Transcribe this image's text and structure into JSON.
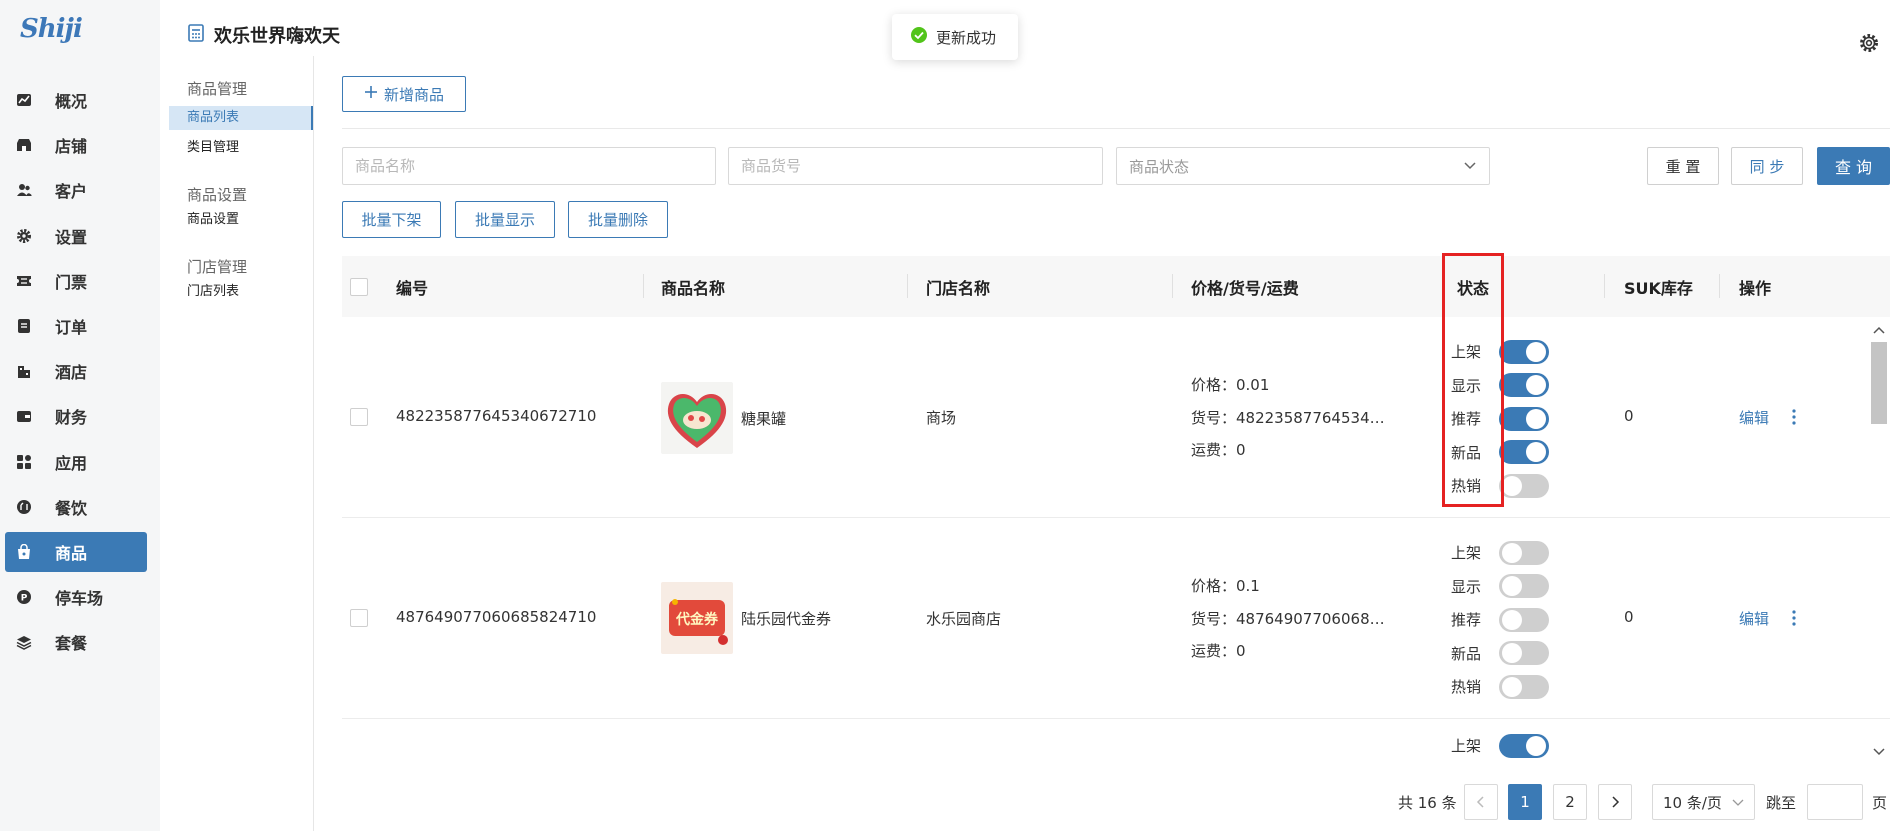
{
  "app": {
    "logo": "Shiji",
    "page_title": "欢乐世界嗨欢天"
  },
  "toast": {
    "message": "更新成功"
  },
  "sidebar": {
    "items": [
      {
        "label": "概况",
        "icon": "chart-icon"
      },
      {
        "label": "店铺",
        "icon": "store-icon"
      },
      {
        "label": "客户",
        "icon": "users-icon"
      },
      {
        "label": "设置",
        "icon": "gear-icon"
      },
      {
        "label": "门票",
        "icon": "ticket-icon"
      },
      {
        "label": "订单",
        "icon": "order-icon"
      },
      {
        "label": "酒店",
        "icon": "hotel-icon"
      },
      {
        "label": "财务",
        "icon": "wallet-icon"
      },
      {
        "label": "应用",
        "icon": "apps-icon"
      },
      {
        "label": "餐饮",
        "icon": "dining-icon"
      },
      {
        "label": "商品",
        "icon": "bag-icon",
        "active": true
      },
      {
        "label": "停车场",
        "icon": "parking-icon"
      },
      {
        "label": "套餐",
        "icon": "layers-icon"
      }
    ]
  },
  "subnav": {
    "group1": "商品管理",
    "item1": "商品列表",
    "item2": "类目管理",
    "group2": "商品设置",
    "item3": "商品设置",
    "group3": "门店管理",
    "item4": "门店列表"
  },
  "toolbar": {
    "add_label": "新增商品"
  },
  "filters": {
    "name_placeholder": "商品名称",
    "sku_placeholder": "商品货号",
    "status_placeholder": "商品状态",
    "reset_label": "重 置",
    "sync_label": "同 步",
    "query_label": "查 询"
  },
  "batch": {
    "offline": "批量下架",
    "show": "批量显示",
    "delete": "批量删除"
  },
  "table": {
    "headers": {
      "id": "编号",
      "name": "商品名称",
      "store": "门店名称",
      "price": "价格/货号/运费",
      "status": "状态",
      "stock": "SUK库存",
      "actions": "操作"
    },
    "status_labels": [
      "上架",
      "显示",
      "推荐",
      "新品",
      "热销"
    ],
    "rows": [
      {
        "id": "482235877645340672710",
        "name": "糖果罐",
        "store": "商场",
        "price": "价格：0.01",
        "sku": "货号：48223587764534…",
        "freight": "运费：0",
        "toggles": [
          true,
          true,
          true,
          true,
          false
        ],
        "stock": "0",
        "edit": "编辑"
      },
      {
        "id": "487649077060685824710",
        "name": "陆乐园代金券",
        "store": "水乐园商店",
        "price": "价格：0.1",
        "sku": "货号：48764907706068…",
        "freight": "运费：0",
        "toggles": [
          false,
          false,
          false,
          false,
          false
        ],
        "stock": "0",
        "edit": "编辑",
        "thumb_text": "代金券"
      },
      {
        "partial_status": "上架",
        "toggle": true
      }
    ]
  },
  "pagination": {
    "total": "共 16 条",
    "pages": [
      "1",
      "2"
    ],
    "current": "1",
    "page_size": "10 条/页",
    "jump_label": "跳至",
    "page_suffix": "页"
  },
  "colors": {
    "primary": "#3b7ab5",
    "highlight": "#e52222",
    "success": "#52c41a"
  }
}
